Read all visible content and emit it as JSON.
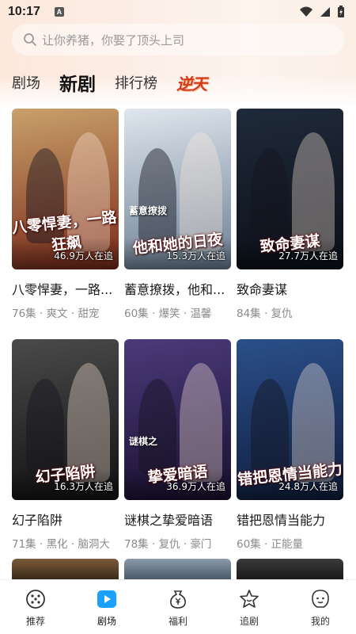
{
  "status_bar": {
    "time": "10:17",
    "notif_letter": "A"
  },
  "search": {
    "placeholder": "让你养猪，你娶了顶头上司"
  },
  "tabs": [
    {
      "label": "剧场",
      "active": false
    },
    {
      "label": "新剧",
      "active": true
    },
    {
      "label": "排行榜",
      "active": false
    },
    {
      "label": "逆天",
      "active": false
    }
  ],
  "dramas": [
    {
      "title": "八零悍妻，一路...",
      "poster_title": "八零悍妻，一路狂飙",
      "poster_sub": "",
      "watching": "46.9万人在追",
      "episodes": "76集",
      "tags": [
        "爽文",
        "甜宠"
      ],
      "colors": [
        "#c9a06a",
        "#7a2a1a"
      ]
    },
    {
      "title": "蓄意撩拨，他和...",
      "poster_title": "他和她的日夜",
      "poster_sub": "蓄意撩拨",
      "watching": "15.3万人在追",
      "episodes": "60集",
      "tags": [
        "爆笑",
        "温馨"
      ],
      "colors": [
        "#dfe6ee",
        "#6b7f93"
      ]
    },
    {
      "title": "致命妻谋",
      "poster_title": "致命妻谋",
      "poster_sub": "",
      "watching": "27.7万人在追",
      "episodes": "84集",
      "tags": [
        "复仇"
      ],
      "colors": [
        "#1f2a3a",
        "#0b1018"
      ]
    },
    {
      "title": "幻子陷阱",
      "poster_title": "幻子陷阱",
      "poster_sub": "",
      "watching": "16.3万人在追",
      "episodes": "71集",
      "tags": [
        "黑化",
        "脑洞大"
      ],
      "colors": [
        "#4a4a4a",
        "#111111"
      ]
    },
    {
      "title": "谜棋之挚爱暗语",
      "poster_title": "挚爱暗语",
      "poster_sub": "谜棋之",
      "watching": "36.9万人在追",
      "episodes": "78集",
      "tags": [
        "复仇",
        "豪门"
      ],
      "colors": [
        "#4a3a7a",
        "#1a1030"
      ]
    },
    {
      "title": "错把恩情当能力",
      "poster_title": "错把恩情当能力",
      "poster_sub": "",
      "watching": "24.8万人在追",
      "episodes": "60集",
      "tags": [
        "正能量"
      ],
      "colors": [
        "#2b4f8a",
        "#0f1e3d"
      ]
    }
  ],
  "nav": [
    {
      "label": "推荐",
      "icon": "dice-icon",
      "active": false
    },
    {
      "label": "剧场",
      "icon": "play-icon",
      "active": true
    },
    {
      "label": "福利",
      "icon": "yen-bag-icon",
      "active": false
    },
    {
      "label": "追剧",
      "icon": "star-face-icon",
      "active": false
    },
    {
      "label": "我的",
      "icon": "profile-face-icon",
      "active": false
    }
  ],
  "colors": {
    "accent": "#1aa0ff",
    "logo_red": "#d33a1f",
    "meta_gray": "#8a8a8a"
  }
}
